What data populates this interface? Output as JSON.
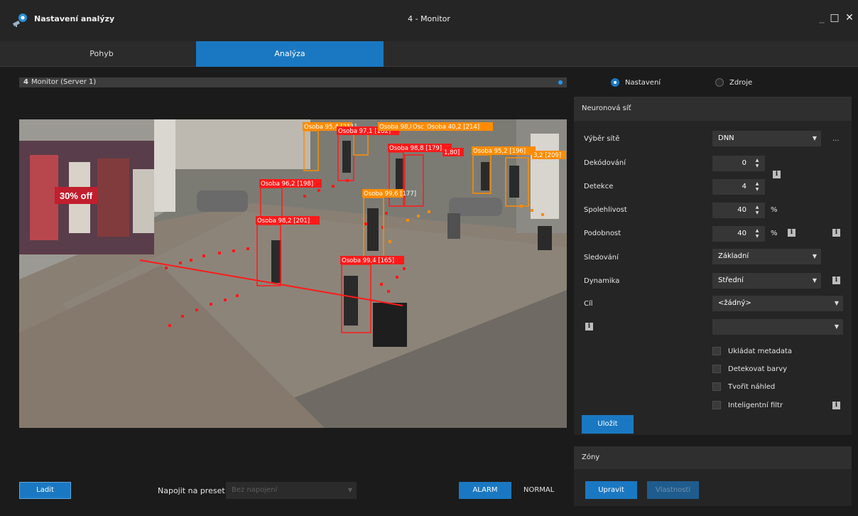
{
  "window": {
    "app_title": "Nastavení analýzy",
    "title": "4 - Monitor",
    "min_glyph": "_",
    "max_glyph": "□",
    "close_glyph": "✕"
  },
  "tabs": [
    {
      "label": "Pohyb",
      "active": false
    },
    {
      "label": "Analýza",
      "active": true
    }
  ],
  "monitor": {
    "number": "4",
    "label": "Monitor (Server 1)"
  },
  "video": {
    "detections": [
      {
        "label": "Osoba  95,4 [211]",
        "color": "#ff8c00"
      },
      {
        "label": "Osoba  97,1 [182]",
        "color": "#ff1a1a"
      },
      {
        "label": "Osoba  98,8 [211]",
        "color": "#ff8c00"
      },
      {
        "label": "Osc",
        "color": "#ff8c00"
      },
      {
        "label": "Osoba  40,2 [214]",
        "color": "#ff8c00"
      },
      {
        "label": "Osoba  98,8 [179]",
        "color": "#ff1a1a"
      },
      {
        "label": "1,80]",
        "color": "#ff1a1a"
      },
      {
        "label": "Osoba  95,2 [196]",
        "color": "#ff8c00"
      },
      {
        "label": "3,2 [209]",
        "color": "#ff8c00"
      },
      {
        "label": "Osoba  96,2 [198]",
        "color": "#ff1a1a"
      },
      {
        "label": "Osoba  99,6 [177]",
        "color": "#ff8c00"
      },
      {
        "label": "Osoba  98,2 [201]",
        "color": "#ff1a1a"
      },
      {
        "label": "Osoba  99,4 [165]",
        "color": "#ff1a1a"
      }
    ],
    "sign_text": "30% off"
  },
  "bottom": {
    "ladit": "Ladit",
    "preset_label": "Napojit na preset",
    "preset_value": "Bez napojení",
    "alarm": "ALARM",
    "normal": "NORMAL"
  },
  "radios": [
    {
      "label": "Nastavení",
      "selected": true
    },
    {
      "label": "Zdroje",
      "selected": false
    }
  ],
  "neural": {
    "header": "Neuronová síť",
    "network_label": "Výběr sítě",
    "network_value": "DNN",
    "network_more": "...",
    "decoding_label": "Dekódování",
    "decoding_value": "0",
    "detection_label": "Detekce",
    "detection_value": "4",
    "confidence_label": "Spolehlivost",
    "confidence_value": "40",
    "confidence_unit": "%",
    "similarity_label": "Podobnost",
    "similarity_value": "40",
    "similarity_unit": "%",
    "tracking_label": "Sledování",
    "tracking_value": "Základní",
    "dynamics_label": "Dynamika",
    "dynamics_value": "Střední",
    "target_label": "Cíl",
    "target_value": "<žádný>",
    "extra_value": "",
    "info_glyph": "i",
    "checkboxes": [
      {
        "label": "Ukládat metadata",
        "checked": false
      },
      {
        "label": "Detekovat barvy",
        "checked": false
      },
      {
        "label": "Tvořit náhled",
        "checked": false
      },
      {
        "label": "Inteligentní filtr",
        "checked": false
      }
    ],
    "save": "Uložit"
  },
  "zones": {
    "header": "Zóny",
    "edit": "Upravit",
    "properties": "Vlastnosti"
  }
}
